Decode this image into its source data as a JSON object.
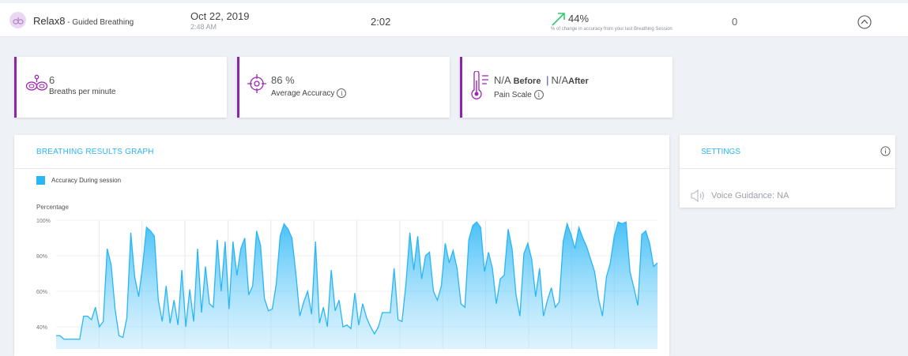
{
  "header": {
    "app_name": "Relax8",
    "app_sub": " - Guided Breathing",
    "date": "Oct 22, 2019",
    "time": "2:48 AM",
    "duration": "2:02",
    "change_value": "44%",
    "change_note": "% of change in accuracy from your last Breathing Session",
    "count": "0",
    "icons": {
      "avatar": "lungs-icon",
      "trend": "trend-up-icon",
      "collapse": "chevron-up-circle-icon"
    },
    "colors": {
      "trend": "#2ecc71",
      "avatar_bg": "#ead8f3"
    }
  },
  "stats": [
    {
      "value": "6",
      "label": "Breaths per minute",
      "icon": "lungs-icon"
    },
    {
      "value": "86 %",
      "label": "Average Accuracy",
      "icon": "target-icon"
    },
    {
      "before_value": "N/A",
      "before_label": "Before",
      "after_value": "N/A",
      "after_label": "After",
      "label": "Pain Scale",
      "icon": "thermometer-icon"
    }
  ],
  "stat_accent": "#8e24aa",
  "graph": {
    "title": "BREATHING RESULTS GRAPH",
    "legend": "Accuracy During session",
    "ylabel": "Percentage",
    "color": "#29b6f6"
  },
  "settings": {
    "title": "SETTINGS",
    "voice_label": "Voice Guidance:",
    "voice_value": "NA",
    "icons": {
      "info": "info-icon",
      "voice": "speaker-icon"
    }
  },
  "chart_data": {
    "type": "area",
    "title": "",
    "xlabel": "",
    "ylabel": "Percentage",
    "ylim": [
      30,
      100
    ],
    "yticks": [
      "100%",
      "80%",
      "60%",
      "40%"
    ],
    "grid": true,
    "legend_position": "top-left",
    "series": [
      {
        "name": "Accuracy During session",
        "color": "#29b6f6",
        "values": [
          35,
          35,
          33,
          33,
          33,
          33,
          33,
          46,
          46,
          44,
          51,
          40,
          43,
          84,
          75,
          50,
          35,
          34,
          45,
          93,
          68,
          57,
          74,
          96,
          94,
          91,
          55,
          43,
          63,
          42,
          55,
          41,
          72,
          40,
          61,
          43,
          84,
          48,
          74,
          53,
          51,
          89,
          60,
          88,
          50,
          88,
          69,
          84,
          90,
          58,
          63,
          94,
          86,
          56,
          49,
          50,
          64,
          91,
          98,
          95,
          90,
          70,
          46,
          54,
          60,
          47,
          88,
          42,
          51,
          40,
          72,
          49,
          55,
          40,
          41,
          39,
          59,
          41,
          53,
          45,
          40,
          36,
          40,
          48,
          48,
          48,
          73,
          44,
          43,
          64,
          93,
          72,
          91,
          67,
          80,
          82,
          60,
          55,
          63,
          87,
          76,
          83,
          73,
          53,
          51,
          89,
          97,
          99,
          96,
          71,
          82,
          73,
          53,
          67,
          69,
          95,
          84,
          58,
          46,
          81,
          87,
          78,
          57,
          73,
          46,
          55,
          62,
          51,
          54,
          88,
          98,
          92,
          84,
          96,
          90,
          85,
          78,
          71,
          56,
          46,
          68,
          76,
          91,
          99,
          98,
          99,
          71,
          62,
          52,
          92,
          94,
          87,
          74,
          76
        ]
      }
    ]
  }
}
